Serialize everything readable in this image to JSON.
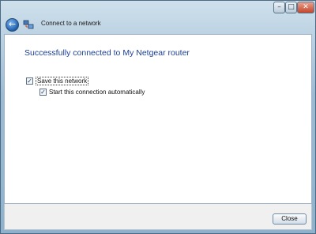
{
  "window": {
    "title": "Connect to a network",
    "controls": {
      "minimize": "–",
      "maximize": "□",
      "close": "✕"
    }
  },
  "icons": {
    "back": "back-arrow-icon",
    "network": "network-icon"
  },
  "content": {
    "headline": "Successfully connected to My Netgear router",
    "save_network": {
      "label": "Save this network",
      "checked": true
    },
    "start_automatically": {
      "label": "Start this connection automatically",
      "checked": true
    }
  },
  "footer": {
    "close_label": "Close"
  },
  "colors": {
    "headline": "#1c3f94",
    "frame": "#9dbcd3"
  }
}
